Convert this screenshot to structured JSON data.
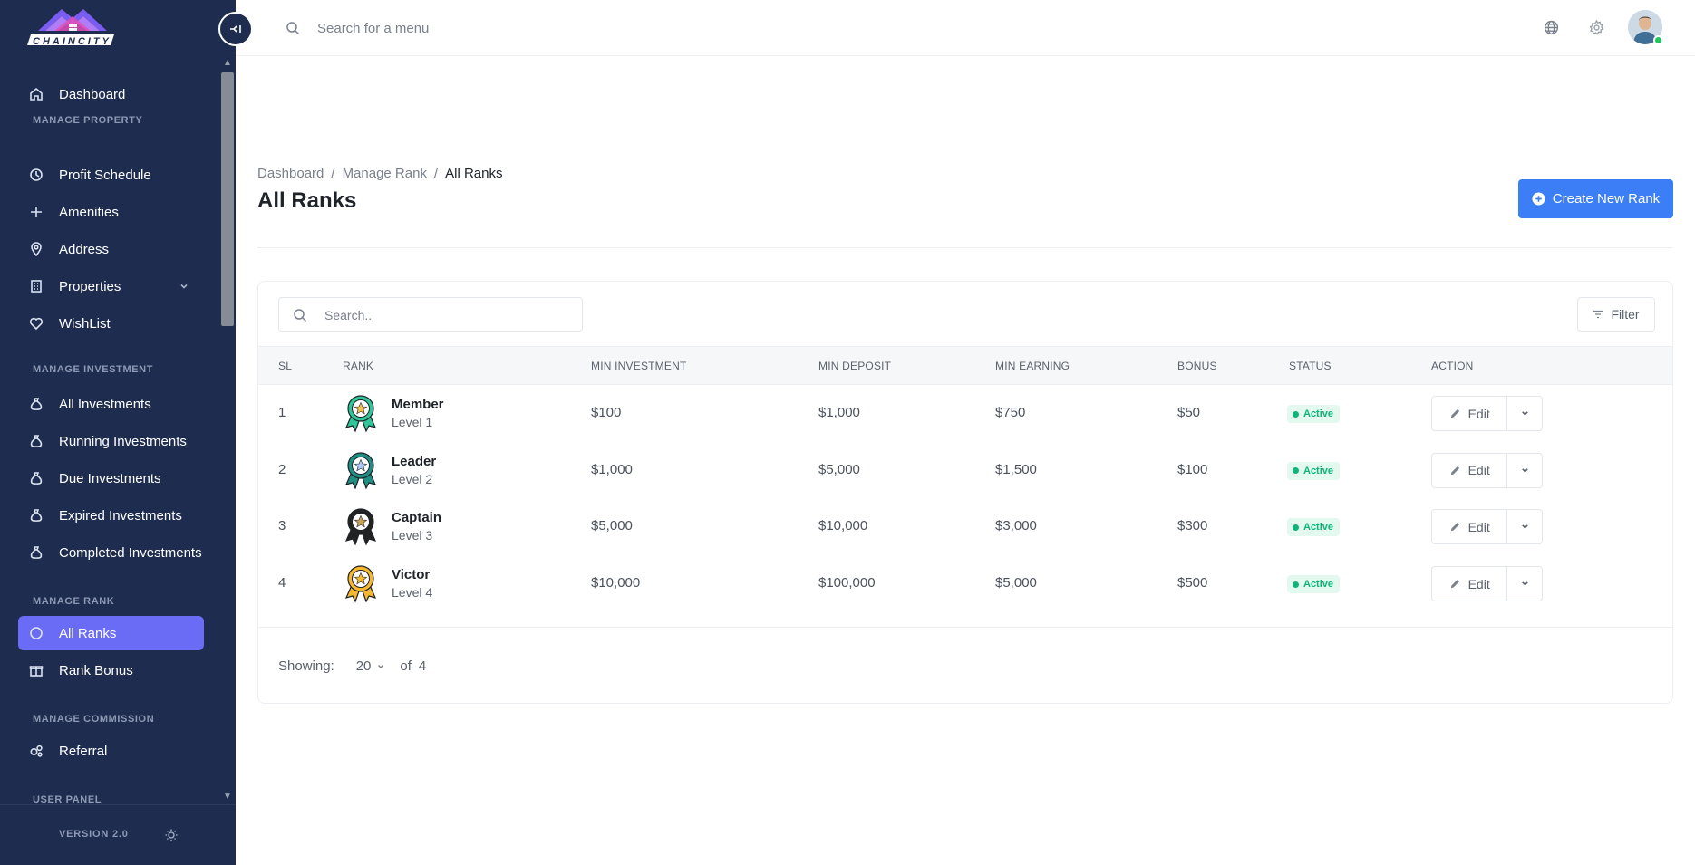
{
  "app": {
    "logo_text": "CHAINCITY",
    "version": "VERSION 2.0"
  },
  "sidebar": {
    "sections": {
      "property": "MANAGE PROPERTY",
      "investment": "MANAGE INVESTMENT",
      "rank": "MANAGE RANK",
      "commission": "MANAGE COMMISSION",
      "user": "USER PANEL"
    },
    "items": {
      "dashboard": "Dashboard",
      "profit_schedule": "Profit Schedule",
      "amenities": "Amenities",
      "address": "Address",
      "properties": "Properties",
      "wishlist": "WishList",
      "all_investments": "All Investments",
      "running_investments": "Running Investments",
      "due_investments": "Due Investments",
      "expired_investments": "Expired Investments",
      "completed_investments": "Completed Investments",
      "all_ranks": "All Ranks",
      "rank_bonus": "Rank Bonus",
      "referral": "Referral"
    }
  },
  "header": {
    "search_placeholder": "Search for a menu"
  },
  "breadcrumb": {
    "home": "Dashboard",
    "parent": "Manage Rank",
    "current": "All Ranks"
  },
  "page": {
    "title": "All Ranks",
    "create_label": "Create New Rank"
  },
  "table": {
    "search_placeholder": "Search..",
    "filter_label": "Filter",
    "columns": {
      "sl": "SL",
      "rank": "RANK",
      "min_investment": "MIN INVESTMENT",
      "min_deposit": "MIN DEPOSIT",
      "min_earning": "MIN EARNING",
      "bonus": "BONUS",
      "status": "STATUS",
      "action": "ACTION"
    },
    "edit_label": "Edit",
    "rows": [
      {
        "sl": "1",
        "name": "Member",
        "level": "Level 1",
        "min_investment": "$100",
        "min_deposit": "$1,000",
        "min_earning": "$750",
        "bonus": "$50",
        "status": "Active",
        "medal_color": "#2fc79a",
        "star_color": "#f2c14e"
      },
      {
        "sl": "2",
        "name": "Leader",
        "level": "Level 2",
        "min_investment": "$1,000",
        "min_deposit": "$5,000",
        "min_earning": "$1,500",
        "bonus": "$100",
        "status": "Active",
        "medal_color": "#1f8f83",
        "star_color": "#a9c7f2"
      },
      {
        "sl": "3",
        "name": "Captain",
        "level": "Level 3",
        "min_investment": "$5,000",
        "min_deposit": "$10,000",
        "min_earning": "$3,000",
        "bonus": "$300",
        "status": "Active",
        "medal_color": "#222222",
        "star_color": "#c9a458"
      },
      {
        "sl": "4",
        "name": "Victor",
        "level": "Level 4",
        "min_investment": "$10,000",
        "min_deposit": "$100,000",
        "min_earning": "$5,000",
        "bonus": "$500",
        "status": "Active",
        "medal_color": "#f5b82e",
        "star_color": "#f5b82e"
      }
    ],
    "pagination": {
      "showing_label": "Showing:",
      "per_page": "20",
      "of_label": "of",
      "total": "4"
    }
  },
  "colors": {
    "sidebar_bg": "#1e2c4f",
    "active_item": "#6b6cf5",
    "primary": "#3b7ef5",
    "success": "#10b47a"
  }
}
